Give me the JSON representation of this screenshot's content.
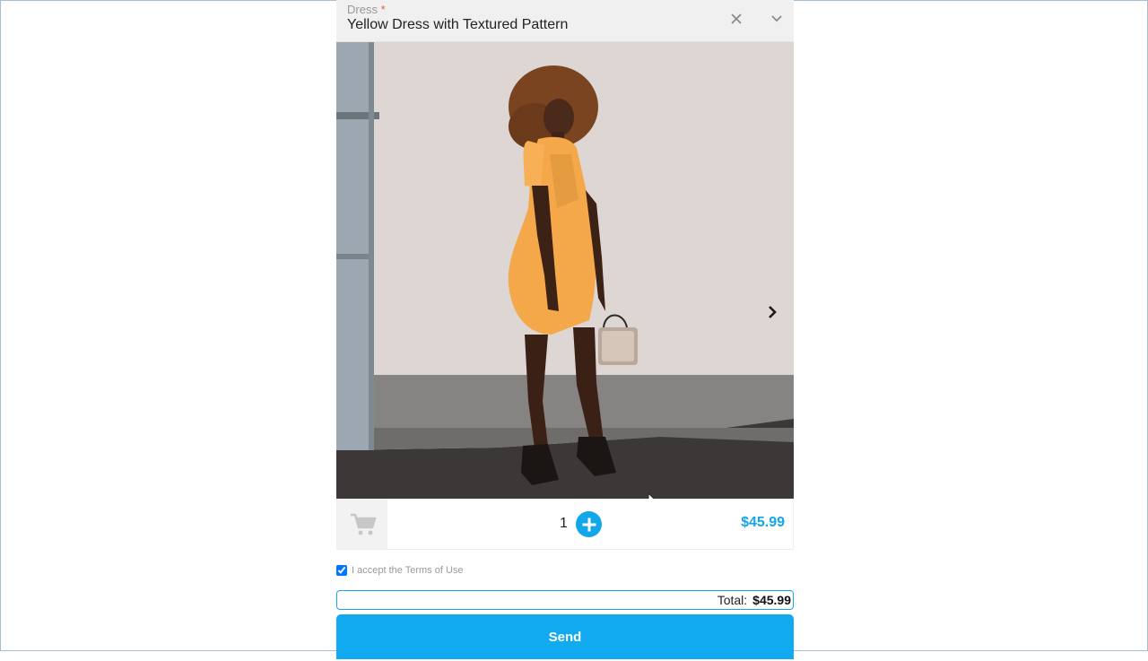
{
  "product_select": {
    "label": "Dress",
    "required_marker": "*",
    "value": "Yellow Dress with Textured Pattern",
    "clear_icon": "close-icon",
    "dropdown_icon": "chevron-down-icon"
  },
  "gallery": {
    "image": "woman-in-orange-dress-photo",
    "next_icon": "chevron-right-icon"
  },
  "order": {
    "cart_icon": "cart-icon",
    "quantity": "1",
    "add_icon": "plus-icon",
    "price": "$45.99"
  },
  "terms": {
    "checked": true,
    "text": "I accept the Terms of Use"
  },
  "total": {
    "label": "Total:",
    "value": "$45.99"
  },
  "submit": {
    "label": "Send"
  },
  "colors": {
    "accent": "#11a7ea",
    "required": "#e0614a"
  }
}
